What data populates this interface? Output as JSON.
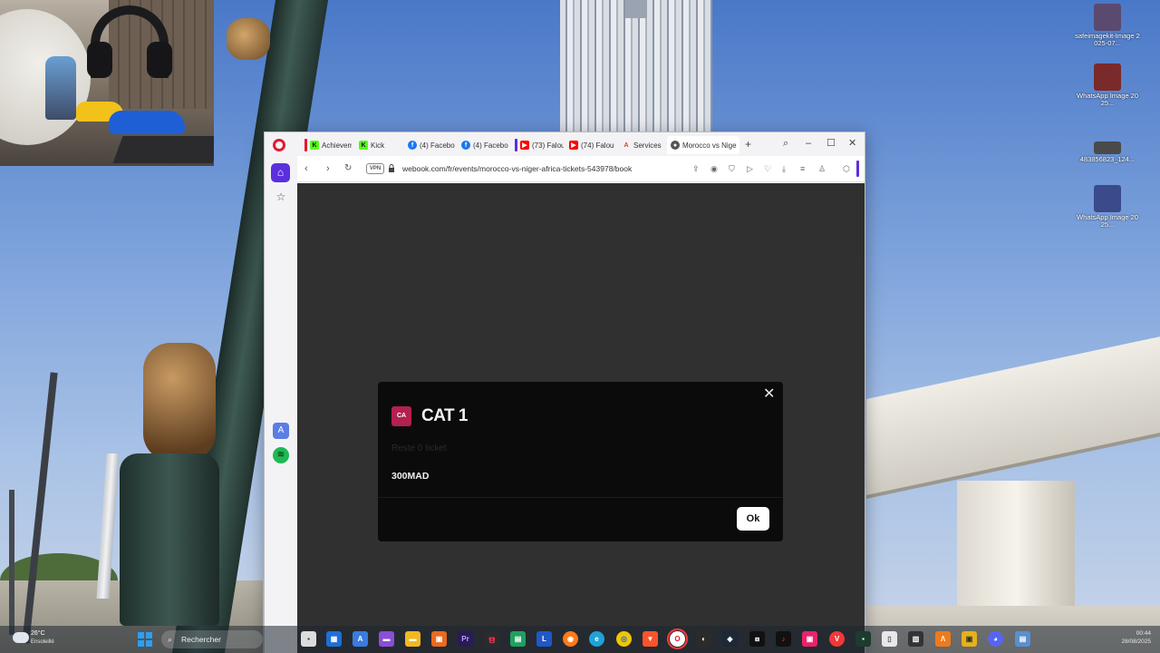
{
  "browser": {
    "tabs": [
      {
        "label": "Achievem",
        "favicon": "kick-icon",
        "color": "#53fc18"
      },
      {
        "label": "Kick",
        "favicon": "kick-icon",
        "color": "#53fc18"
      },
      {
        "label": "(4) Facebo",
        "favicon": "facebook-icon",
        "color": "#1877f2"
      },
      {
        "label": "(4) Facebo",
        "favicon": "facebook-icon",
        "color": "#1877f2"
      },
      {
        "label": "(73) Falou",
        "favicon": "youtube-icon",
        "color": "#ff0000"
      },
      {
        "label": "(74) Falou",
        "favicon": "youtube-icon",
        "color": "#ff0000"
      },
      {
        "label": "Services",
        "favicon": "app-icon",
        "color": "#e33"
      },
      {
        "label": "Morocco vs Nige",
        "favicon": "globe-icon",
        "color": "#444"
      }
    ],
    "url": "webook.com/fr/events/morocco-vs-niger-africa-tickets-543978/book",
    "vpn_label": "VPN"
  },
  "modal": {
    "badge": "CA",
    "title": "CAT 1",
    "subtitle": "Reste 0 ticket",
    "price": "300MAD",
    "ok_label": "Ok"
  },
  "desktop": {
    "icons": [
      {
        "label": "safeimagekit-Image 2025-07...",
        "color": "#5a4a70"
      },
      {
        "label": "WhatsApp Image 2025...",
        "color": "#7a2a2a"
      },
      {
        "label": "483856823_124...",
        "color": "#4a4a4a"
      },
      {
        "label": "WhatsApp Image 2025...",
        "color": "#3a4a8a"
      }
    ]
  },
  "taskbar": {
    "search_placeholder": "Rechercher",
    "weather_temp": "26°C",
    "weather_cond": "Ensoleillé",
    "time": "00:44",
    "date": "28/08/2025"
  },
  "colors": {
    "accent": "#5b2ede",
    "badge": "#b3214f",
    "modal_bg": "#0b0b0c",
    "page_bg": "#303031"
  }
}
